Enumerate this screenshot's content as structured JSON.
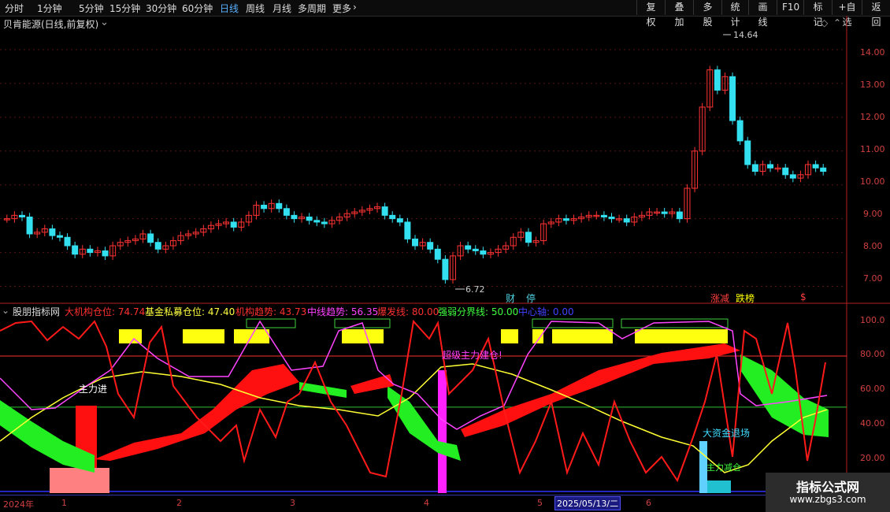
{
  "toolbar": {
    "periods": [
      "分时",
      "1分钟",
      "5分钟",
      "15分钟",
      "30分钟",
      "60分钟",
      "日线",
      "周线",
      "月线",
      "多周期",
      "更多"
    ],
    "active_period": "日线",
    "right_buttons": [
      "复权",
      "叠加",
      "多股",
      "统计",
      "画线",
      "F10",
      "标记",
      "+自选",
      "返回"
    ]
  },
  "price_panel": {
    "title": "贝肯能源(日线,前复权)",
    "high_label": "14.64",
    "low_label": "6.72",
    "y_axis": [
      "14.00",
      "13.00",
      "12.00",
      "11.00",
      "10.00",
      "9.00",
      "8.00",
      "7.00"
    ],
    "y_range": [
      6.5,
      15.0
    ],
    "markers": [
      {
        "text": "财",
        "color": "#4fd0e0"
      },
      {
        "text": "停",
        "color": "#4fd0e0"
      },
      {
        "text": "涨减",
        "color": "#ff4040"
      },
      {
        "text": "跌榜",
        "color": "#ffff00"
      },
      {
        "text": "$",
        "color": "#ff4040"
      }
    ]
  },
  "indicator_panel": {
    "name": "股朋指标网",
    "params": [
      {
        "label": "大机构仓位:",
        "value": "74.74",
        "color": "#ff3030"
      },
      {
        "label": "基金私募仓位:",
        "value": "47.40",
        "color": "#ffff40"
      },
      {
        "label": "机构趋势:",
        "value": "43.73",
        "color": "#ff3030"
      },
      {
        "label": "中线趋势:",
        "value": "56.35",
        "color": "#ff40ff"
      },
      {
        "label": "爆发线:",
        "value": "80.00",
        "color": "#ff3030"
      },
      {
        "label": "强弱分界线:",
        "value": "50.00",
        "color": "#40ff40"
      },
      {
        "label": "中心轴:",
        "value": "0.00",
        "color": "#4040ff"
      }
    ],
    "y_axis": [
      "100.0",
      "80.00",
      "60.00",
      "40.00",
      "20.00"
    ],
    "y_range": [
      0,
      105
    ],
    "annotations": [
      "主力进",
      "超级主力建仓!",
      "大资金退场",
      "主力减仓"
    ]
  },
  "dates": [
    "2024年",
    "1",
    "2",
    "3",
    "4",
    "5",
    "2025/05/13/二",
    "6"
  ],
  "logo": {
    "title": "指标公式网",
    "url": "www.zbgs3.com"
  },
  "colors": {
    "up": "#ff3333",
    "down": "#33e0f0",
    "ma_yellow": "#ffff33",
    "line_magenta": "#ff44ff",
    "green": "#22ff22"
  }
}
